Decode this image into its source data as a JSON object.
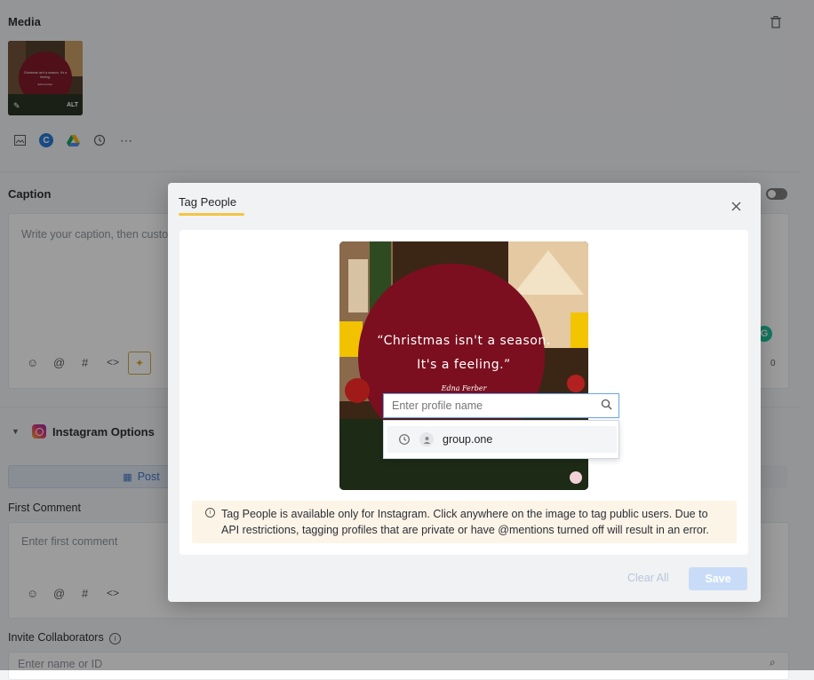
{
  "background": {
    "media_title": "Media",
    "caption_title": "Caption",
    "caption_placeholder": "Write your caption, then custo",
    "caption_count": "0",
    "instagram_options_title": "Instagram Options",
    "post_tab_label": "Post",
    "first_comment_title": "First Comment",
    "first_comment_placeholder": "Enter first comment",
    "invite_collaborators_title": "Invite Collaborators",
    "collaborator_placeholder": "Enter name or ID",
    "thumb_quote": "Christmas isn't a season. It's a feeling.",
    "thumb_author": "Edna Ferber",
    "thumb_alt": "ALT"
  },
  "modal": {
    "tab_label": "Tag People",
    "image_quote_line1": "“Christmas isn't a season.",
    "image_quote_line2": "It's a feeling.”",
    "image_author": "Edna Ferber",
    "search_placeholder": "Enter profile name",
    "suggestion_name": "group.one",
    "info_text": "Tag People is available only for Instagram. Click anywhere on the image to tag public users. Due to API restrictions, tagging profiles that are private or have @mentions turned off will result in an error.",
    "clear_all_label": "Clear All",
    "save_label": "Save"
  },
  "colors": {
    "accent_underline": "#f5c542",
    "save_button": "#c9dcf7",
    "info_bg": "#fdf4e8",
    "circle": "#7b0f1f"
  }
}
